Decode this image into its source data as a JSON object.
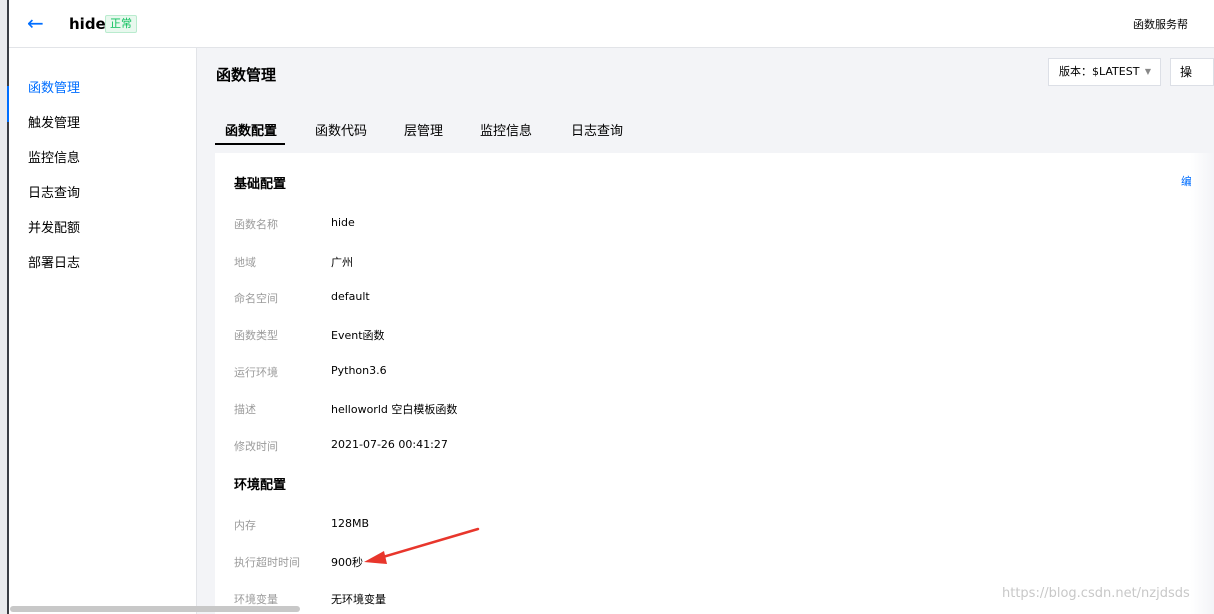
{
  "header": {
    "function_name": "hide",
    "status": "正常",
    "help_link": "函数服务帮"
  },
  "sidebar": {
    "items": [
      {
        "label": "函数管理",
        "active": true
      },
      {
        "label": "触发管理"
      },
      {
        "label": "监控信息"
      },
      {
        "label": "日志查询"
      },
      {
        "label": "并发配额"
      },
      {
        "label": "部署日志"
      }
    ]
  },
  "main": {
    "title": "函数管理",
    "version_label": "版本：$LATEST",
    "op_button_label": "操",
    "tabs": [
      "函数配置",
      "函数代码",
      "层管理",
      "监控信息",
      "日志查询"
    ],
    "active_tab": 0
  },
  "basic_config": {
    "title": "基础配置",
    "edit_label": "编",
    "fields": [
      {
        "label": "函数名称",
        "value": "hide"
      },
      {
        "label": "地域",
        "value": "广州"
      },
      {
        "label": "命名空间",
        "value": "default"
      },
      {
        "label": "函数类型",
        "value": "Event函数"
      },
      {
        "label": "运行环境",
        "value": "Python3.6"
      },
      {
        "label": "描述",
        "value": "helloworld 空白模板函数"
      },
      {
        "label": "修改时间",
        "value": "2021-07-26 00:41:27"
      }
    ]
  },
  "env_config": {
    "title": "环境配置",
    "fields": [
      {
        "label": "内存",
        "value": "128MB"
      },
      {
        "label": "执行超时时间",
        "value": "900秒"
      },
      {
        "label": "环境变量",
        "value": "无环境变量"
      }
    ]
  },
  "annotation": {
    "color": "#e8362c"
  },
  "watermark": "https://blog.csdn.net/nzjdsds",
  "colors": {
    "accent": "#006eff",
    "status_green": "#0abf5b"
  }
}
